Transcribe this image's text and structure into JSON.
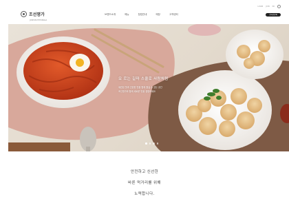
{
  "header": {
    "logo_text": "조선명가",
    "logo_sub": "JOSEON MYEONGGA",
    "nav": [
      "브랜드소개",
      "메뉴",
      "창업안내",
      "매장",
      "고객센터"
    ],
    "util": [
      "LOGIN",
      "JOIN",
      "KR"
    ],
    "login_label": "온라인문의"
  },
  "hero": {
    "title": "오 르는 길마 스쿨로 사람처럼",
    "desc": [
      "세련된 맛과 건강한 맛을 함께 즐길 수 있는 공간",
      "조선명가와 함께 새로운 맛을 경험하세요"
    ],
    "slide_count": 4,
    "active_slide": 1
  },
  "intro": {
    "lines": [
      "안전하고 신선한",
      "바른 먹거리를 위해",
      "노력합니다."
    ]
  }
}
